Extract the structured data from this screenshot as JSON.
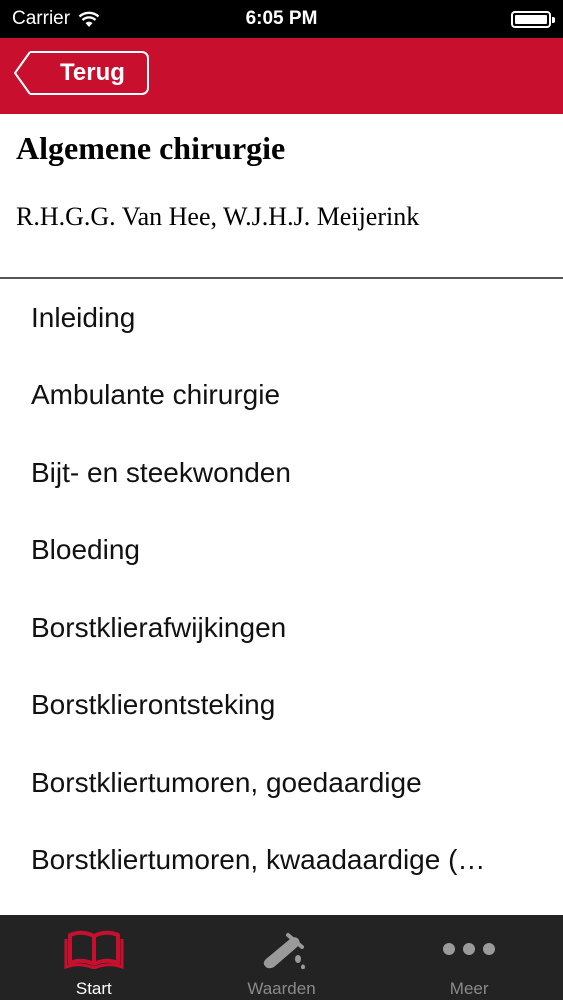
{
  "status_bar": {
    "carrier": "Carrier",
    "time": "6:05 PM"
  },
  "nav": {
    "back_label": "Terug"
  },
  "header": {
    "title": "Algemene chirurgie",
    "authors": "R.H.G.G. Van Hee, W.J.H.J. Meijerink"
  },
  "list": {
    "items": [
      "Inleiding",
      "Ambulante chirurgie",
      "Bijt- en steekwonden",
      "Bloeding",
      "Borstklierafwijkingen",
      "Borstklierontsteking",
      "Borstkliertumoren, goedaardige",
      "Borstkliertumoren, kwaadaardige (…"
    ]
  },
  "tabs": [
    {
      "label": "Start",
      "icon": "book-icon",
      "active": true
    },
    {
      "label": "Waarden",
      "icon": "lab-flask-icon",
      "active": false
    },
    {
      "label": "Meer",
      "icon": "more-dots-icon",
      "active": false
    }
  ],
  "colors": {
    "accent": "#c8102e",
    "tab_bar": "#232323"
  }
}
